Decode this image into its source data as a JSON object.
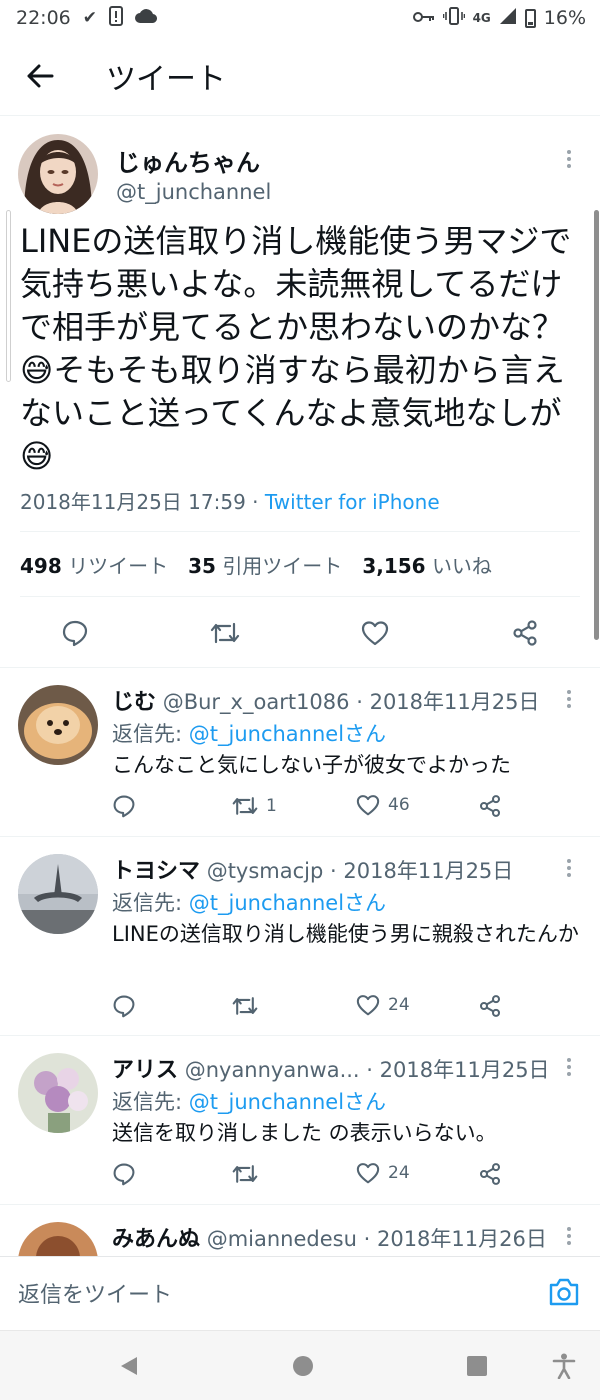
{
  "status_bar": {
    "time": "22:06",
    "network": "4G",
    "battery": "16%",
    "icons": [
      "check-icon",
      "sim-alert-icon",
      "cloud-icon",
      "key-icon",
      "vibrate-icon",
      "signal-icon",
      "battery-icon"
    ]
  },
  "header": {
    "title": "ツイート"
  },
  "tweet": {
    "name": "じゅんちゃん",
    "handle": "@t_junchannel",
    "text": "LINEの送信取り消し機能使う男マジで気持ち悪いよな。未読無視してるだけで相手が見てるとか思わないのかな？😅そもそも取り消すなら最初から言えないこと送ってくんなよ意気地なしが😅",
    "timestamp": "2018年11月25日 17:59",
    "meta_sep": " · ",
    "source": "Twitter for iPhone",
    "stats": {
      "retweets_count": "498",
      "retweets_label": "リツイート",
      "quotes_count": "35",
      "quotes_label": "引用ツイート",
      "likes_count": "3,156",
      "likes_label": "いいね"
    }
  },
  "replies": [
    {
      "name": "じむ",
      "handle": "@Bur_x_oart1086",
      "date": "2018年11月25日",
      "reply_to_label": "返信先: ",
      "reply_to": "@t_junchannelさん",
      "text": "こんなこと気にしない子が彼女でよかった",
      "retweets": "1",
      "likes": "46"
    },
    {
      "name": "トヨシマ",
      "handle": "@tysmacjp",
      "date": "2018年11月25日",
      "reply_to_label": "返信先: ",
      "reply_to": "@t_junchannelさん",
      "text": "LINEの送信取り消し機能使う男に親殺されたんか",
      "retweets": "",
      "likes": "24"
    },
    {
      "name": "アリス",
      "handle": "@nyannyanwa...",
      "date": "2018年11月25日",
      "reply_to_label": "返信先: ",
      "reply_to": "@t_junchannelさん",
      "text": "送信を取り消しました の表示いらない。",
      "retweets": "",
      "likes": "24"
    },
    {
      "name": "みあんぬ",
      "handle": "@miannedesu",
      "date": "2018年11月26日"
    }
  ],
  "composer": {
    "placeholder": "返信をツイート"
  },
  "colors": {
    "accent": "#1d9bf0",
    "secondary_text": "#536471",
    "text": "#0f1419"
  }
}
